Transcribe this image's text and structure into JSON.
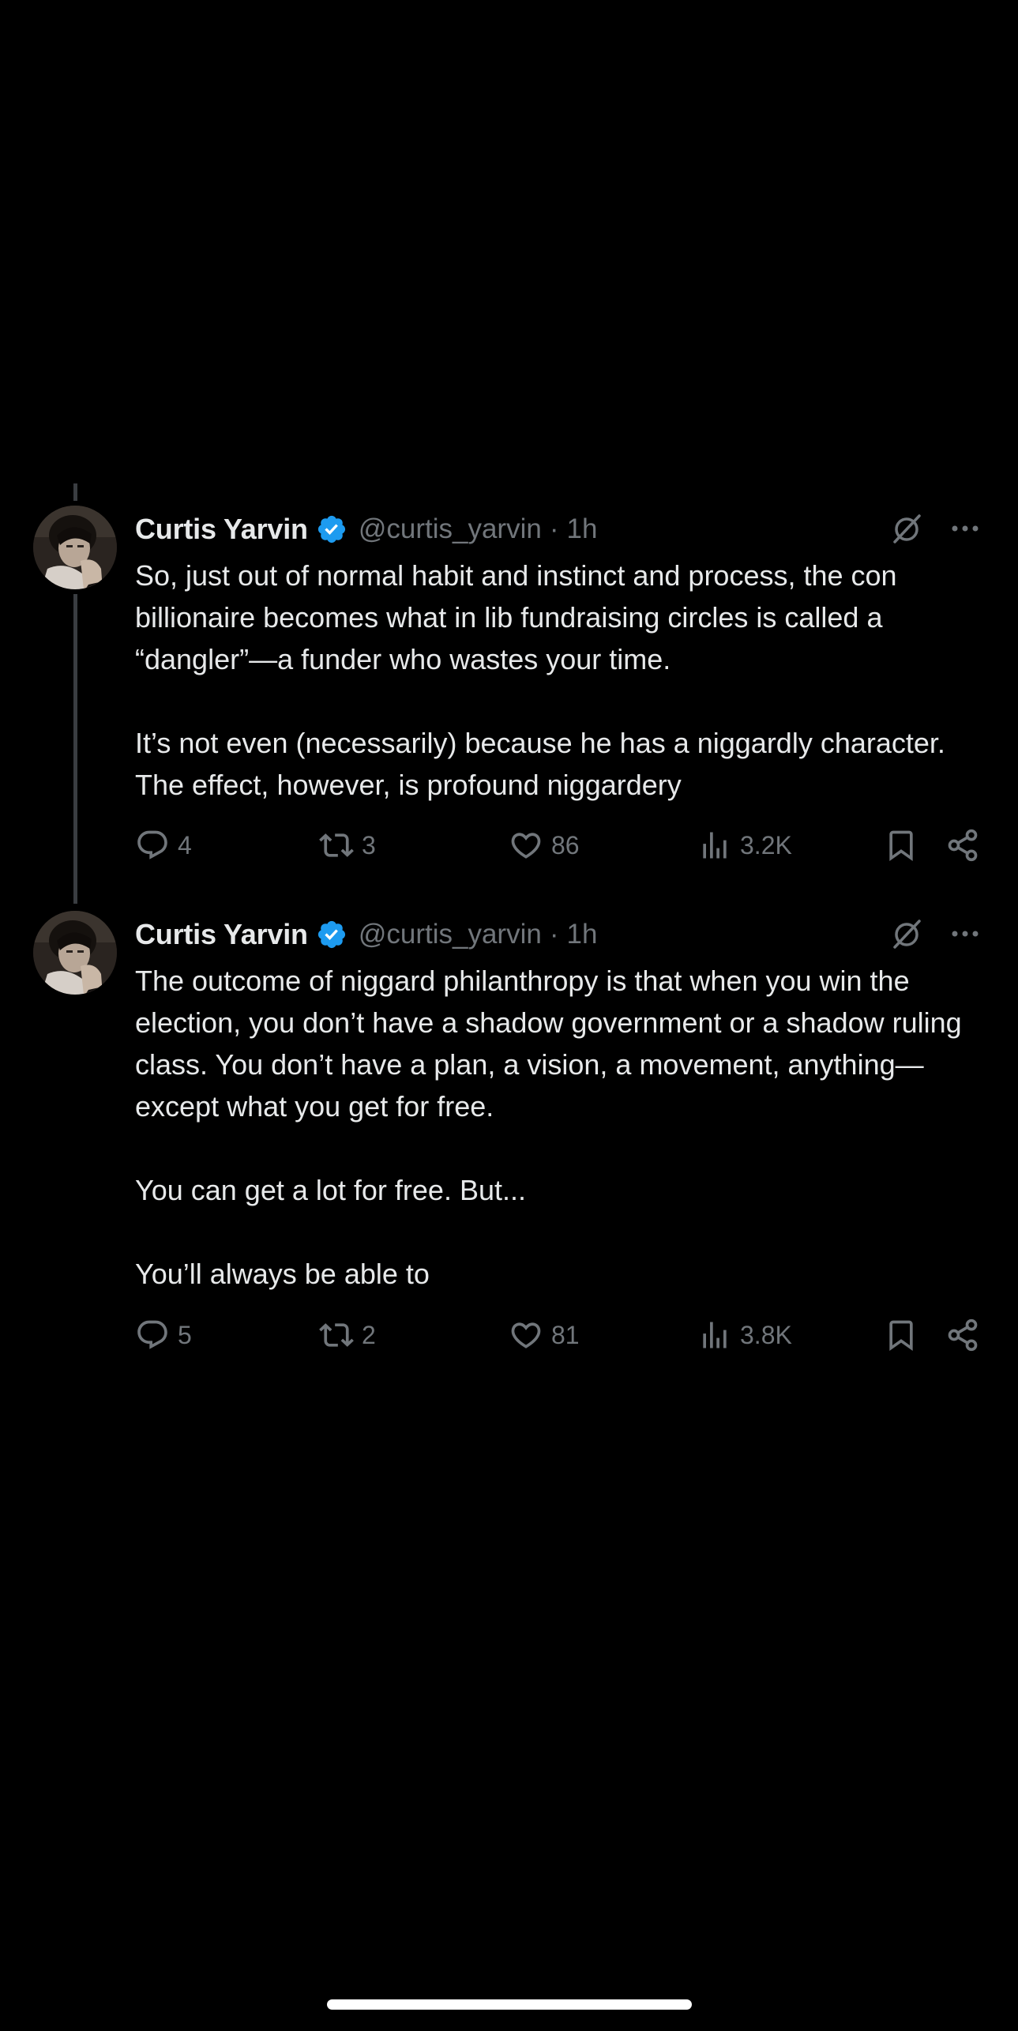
{
  "tweets": [
    {
      "author": {
        "name": "Curtis Yarvin",
        "handle": "@curtis_yarvin",
        "verified": true
      },
      "separator": "·",
      "time": "1h",
      "paragraphs": [
        "So, just out of normal habit and instinct and process, the con billionaire becomes what in lib fundraising circles is called a “dangler”—a funder who wastes your time.",
        "It’s not even (necessarily) because he has a niggardly character. The effect, however, is profound niggardery"
      ],
      "stats": {
        "replies": "4",
        "retweets": "3",
        "likes": "86",
        "views": "3.2K"
      }
    },
    {
      "author": {
        "name": "Curtis Yarvin",
        "handle": "@curtis_yarvin",
        "verified": true
      },
      "separator": "·",
      "time": "1h",
      "paragraphs": [
        "The outcome of niggard philanthropy is that when you win the election, you don’t have a shadow government or a shadow ruling class. You don’t have a plan, a vision, a movement, anything—except what you get for free.",
        "You can get a lot for free. But...",
        "You’ll always be able to"
      ],
      "stats": {
        "replies": "5",
        "retweets": "2",
        "likes": "81",
        "views": "3.8K"
      }
    }
  ],
  "icons": {
    "verified": "verified-badge-icon",
    "grok": "grok-icon",
    "more": "more-options-icon",
    "reply": "reply-icon",
    "retweet": "retweet-icon",
    "like": "heart-icon",
    "views": "views-chart-icon",
    "bookmark": "bookmark-icon",
    "share": "share-icon"
  },
  "colors": {
    "background": "#000000",
    "primary_text": "#e7e9ea",
    "secondary_text": "#71767b",
    "verified_blue": "#1d9bf0",
    "thread_line": "#3a3d41"
  }
}
